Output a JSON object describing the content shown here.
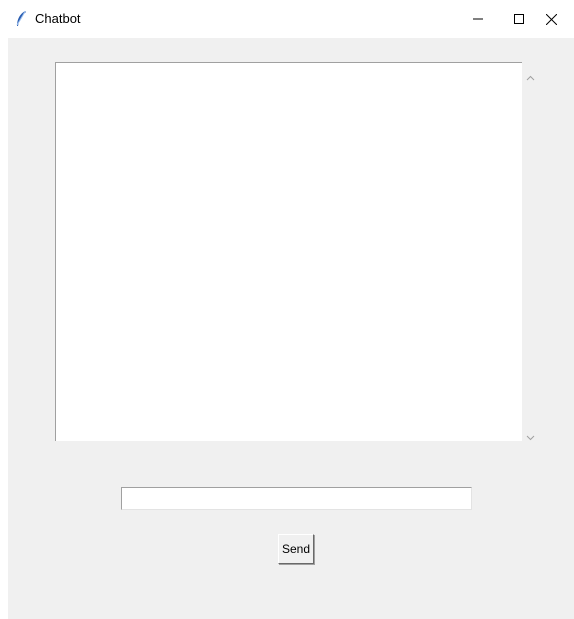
{
  "window": {
    "title": "Chatbot",
    "app_icon": "feather-icon",
    "controls": [
      "minimize-icon",
      "maximize-icon",
      "close-icon"
    ]
  },
  "chat_log": {
    "content": ""
  },
  "input": {
    "value": ""
  },
  "send_button": {
    "label": "Send"
  },
  "scrollbar": {
    "up_icon": "chevron-up-icon",
    "down_icon": "chevron-down-icon"
  }
}
